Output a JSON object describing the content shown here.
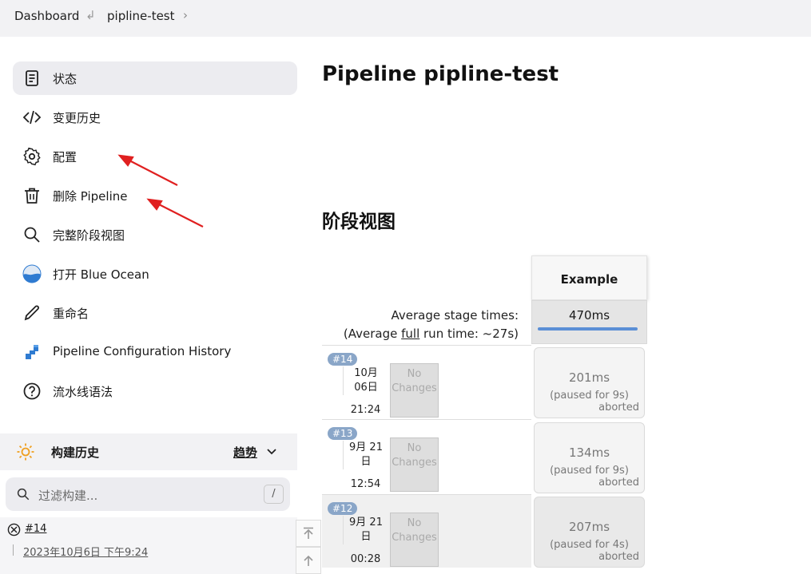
{
  "breadcrumb": {
    "items": [
      "Dashboard",
      "pipline-test"
    ]
  },
  "sidebar": {
    "items": [
      {
        "label": "状态",
        "icon": "document-icon"
      },
      {
        "label": "变更历史",
        "icon": "code-icon"
      },
      {
        "label": "配置",
        "icon": "gear-icon"
      },
      {
        "label": "删除 Pipeline",
        "icon": "trash-icon"
      },
      {
        "label": "完整阶段视图",
        "icon": "search-icon"
      },
      {
        "label": "打开 Blue Ocean",
        "icon": "blue-ocean-icon"
      },
      {
        "label": "重命名",
        "icon": "pencil-icon"
      },
      {
        "label": "Pipeline Configuration History",
        "icon": "config-history-icon"
      },
      {
        "label": "流水线语法",
        "icon": "help-icon"
      }
    ]
  },
  "main": {
    "title": "Pipeline pipline-test",
    "stage_view_title": "阶段视图",
    "average_label": "Average stage times:",
    "full_run_prefix": "(Average ",
    "full_run_link": "full",
    "full_run_suffix": " run time: ~27s)",
    "stage_name": "Example",
    "stage_avg": "470ms",
    "runs": [
      {
        "badge": "#14",
        "date_l1": "10月",
        "date_l2": "06日",
        "time": "21:24",
        "no_changes_1": "No",
        "no_changes_2": "Changes",
        "duration": "201ms",
        "paused": "(paused for 9s)",
        "status": "aborted"
      },
      {
        "badge": "#13",
        "date_l1": "9月 21",
        "date_l2": "日",
        "time": "12:54",
        "no_changes_1": "No",
        "no_changes_2": "Changes",
        "duration": "134ms",
        "paused": "(paused for 9s)",
        "status": "aborted"
      },
      {
        "badge": "#12",
        "date_l1": "9月 21",
        "date_l2": "日",
        "time": "00:28",
        "no_changes_1": "No",
        "no_changes_2": "Changes",
        "duration": "207ms",
        "paused": "(paused for 4s)",
        "status": "aborted"
      }
    ]
  },
  "build_history": {
    "title": "构建历史",
    "trend_label": "趋势",
    "search_placeholder": "过滤构建...",
    "shortcut": "/",
    "entries": [
      {
        "number": "#14",
        "timestamp": "2023年10月6日 下午9:24"
      }
    ]
  },
  "colors": {
    "stage_bar": "#5b8fd6",
    "arrow": "#e02020",
    "badge": "#8aa6c8"
  }
}
